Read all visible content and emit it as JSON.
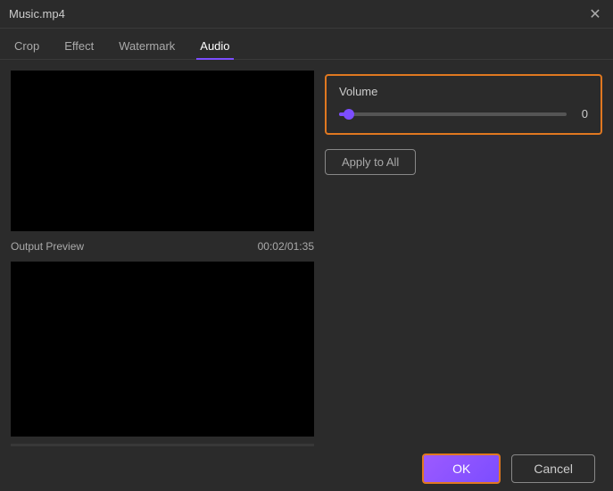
{
  "titleBar": {
    "title": "Music.mp4",
    "closeLabel": "✕"
  },
  "tabs": [
    {
      "id": "crop",
      "label": "Crop",
      "active": false
    },
    {
      "id": "effect",
      "label": "Effect",
      "active": false
    },
    {
      "id": "watermark",
      "label": "Watermark",
      "active": false
    },
    {
      "id": "audio",
      "label": "Audio",
      "active": true
    }
  ],
  "leftPanel": {
    "outputPreviewLabel": "Output Preview",
    "timestamp": "00:02/01:35"
  },
  "controls": {
    "prevFrame": "⏮",
    "play": "▶",
    "nextFrame": "⏭"
  },
  "rightPanel": {
    "volumeLabel": "Volume",
    "volumeValue": "0",
    "applyAllLabel": "Apply to All"
  },
  "footer": {
    "okLabel": "OK",
    "cancelLabel": "Cancel"
  }
}
